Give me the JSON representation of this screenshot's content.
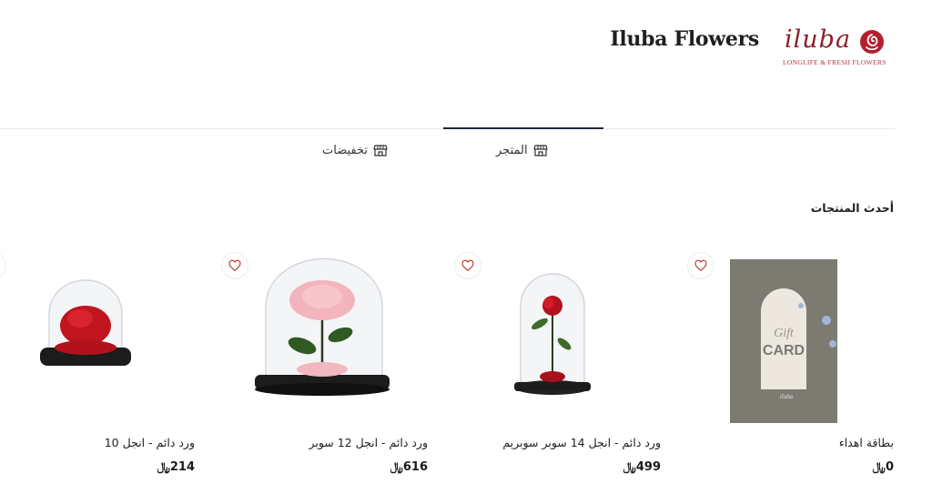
{
  "header": {
    "store_name": "Iluba Flowers",
    "logo_word": "iluba",
    "logo_tagline": "LONGLIFE & FRESH FLOWERS"
  },
  "tabs": [
    {
      "label": "المتجر",
      "icon": "store-icon",
      "active": true
    },
    {
      "label": "تخفيضات",
      "icon": "store-icon",
      "active": false
    }
  ],
  "section": {
    "title": "أحدث المنتجات"
  },
  "currency_symbol": "﷼",
  "products": [
    {
      "name": "بطاقة اهداء",
      "price": "0",
      "image": "gift-card-image"
    },
    {
      "name": "ورد دائم - انجل 14 سوبر سوبريم",
      "price": "499",
      "image": "red-rose-dome-image"
    },
    {
      "name": "ورد دائم - انجل 12 سوبر",
      "price": "616",
      "image": "pink-rose-dome-image"
    },
    {
      "name": "ورد دائم - انجل 10",
      "price": "214",
      "image": "red-rose-small-dome-image"
    }
  ],
  "colors": {
    "accent": "#8b1e2b",
    "heart": "#c0392b",
    "tab_line": "#1f2937"
  }
}
